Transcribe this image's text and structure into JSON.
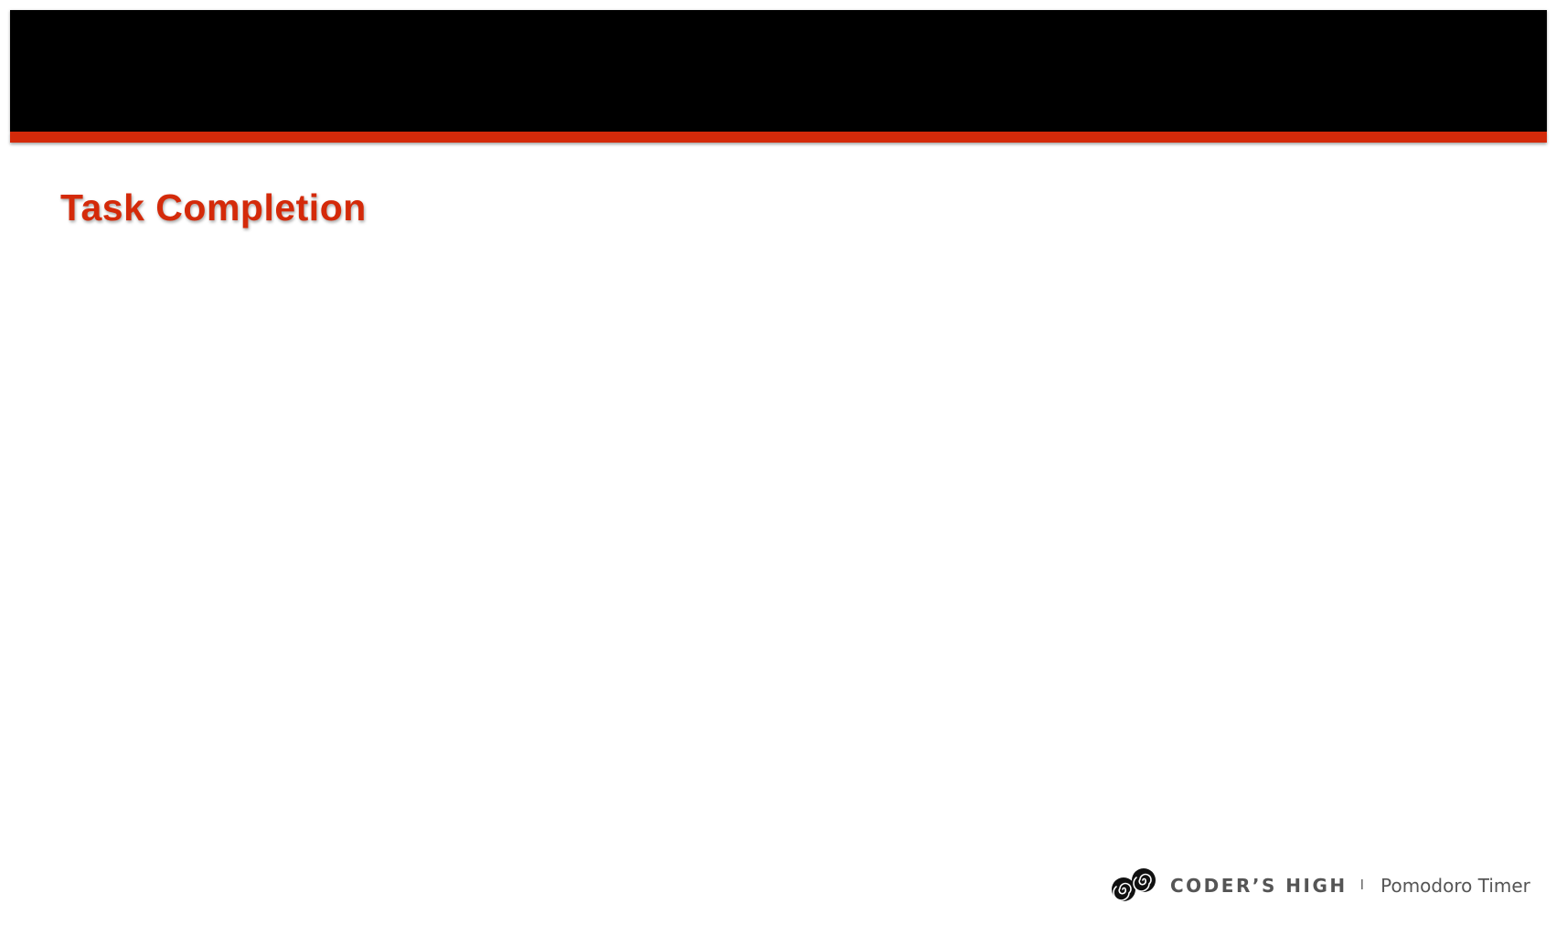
{
  "slide": {
    "title": "Task Completion"
  },
  "footer": {
    "brand": "CODER’S HIGH",
    "separator": "I",
    "product": "Pomodoro Timer",
    "logo_icon": "spiral-eyes-logo-icon"
  },
  "colors": {
    "header": "#000000",
    "accent": "#d42a0a",
    "background": "#ffffff",
    "footer_text": "#555555"
  }
}
